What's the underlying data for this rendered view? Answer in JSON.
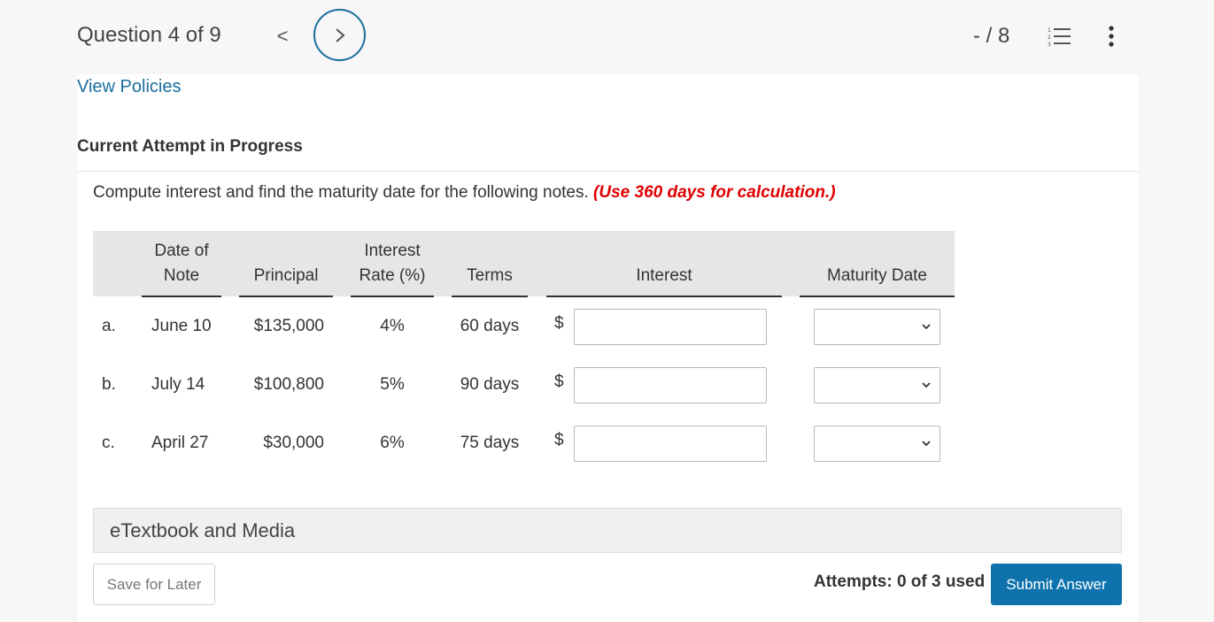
{
  "header": {
    "question_progress": "Question 4 of 9",
    "prev_label": "<",
    "score": "- / 8"
  },
  "links": {
    "view_policies": "View Policies"
  },
  "attempt_heading": "Current Attempt in Progress",
  "instructions": {
    "text": "Compute interest and find the maturity date for the following notes.",
    "note": "(Use 360 days for calculation.)"
  },
  "table": {
    "headers": {
      "date_line1": "Date of",
      "date_line2": "Note",
      "principal": "Principal",
      "rate_line1": "Interest",
      "rate_line2": "Rate (%)",
      "terms": "Terms",
      "interest": "Interest",
      "maturity": "Maturity Date"
    },
    "currency_symbol": "$",
    "rows": [
      {
        "label": "a.",
        "date": "June 10",
        "principal": "$135,000",
        "rate": "4%",
        "terms": "60 days",
        "interest_value": "",
        "maturity_value": ""
      },
      {
        "label": "b.",
        "date": "July 14",
        "principal": "$100,800",
        "rate": "5%",
        "terms": "90 days",
        "interest_value": "",
        "maturity_value": ""
      },
      {
        "label": "c.",
        "date": "April 27",
        "principal": "$30,000",
        "rate": "6%",
        "terms": "75 days",
        "interest_value": "",
        "maturity_value": ""
      }
    ]
  },
  "etextbook": "eTextbook and Media",
  "footer": {
    "save_label": "Save for Later",
    "attempts": "Attempts: 0 of 3 used",
    "submit_label": "Submit Answer"
  },
  "colors": {
    "link": "#1a6e9e",
    "note_red": "#e00000",
    "submit_bg": "#0e72ad"
  },
  "icons": [
    "chevron-left-icon",
    "chevron-right-icon",
    "numbered-list-icon",
    "more-vertical-icon",
    "chevron-down-icon"
  ]
}
